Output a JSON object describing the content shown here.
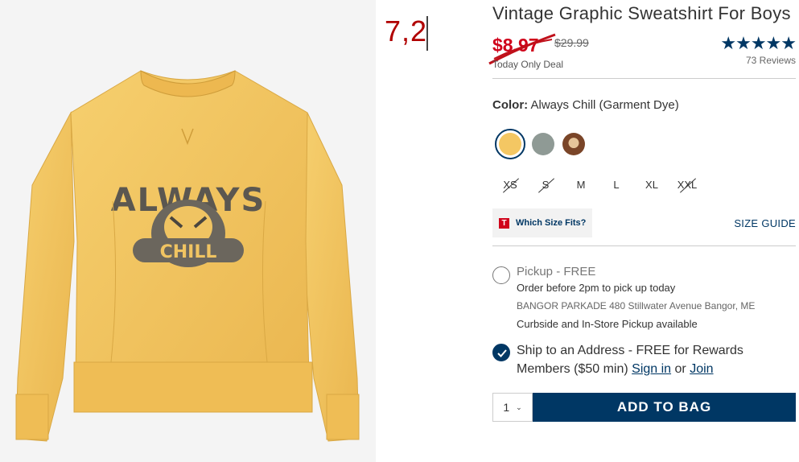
{
  "annotation": {
    "text": "7,2"
  },
  "product": {
    "title": "Vintage Graphic Sweatshirt For Boys",
    "sale_price": "$8.97",
    "original_price": "$29.99",
    "deal_label": "Today Only Deal",
    "stars": "★★★★★",
    "reviews": "73 Reviews",
    "rating": 5,
    "image_text_top": "ALWAYS",
    "image_text_board": "CHILL"
  },
  "color": {
    "label": "Color:",
    "value": "Always Chill (Garment Dye)",
    "swatches": [
      {
        "name": "yellow",
        "hex": "#f4c763",
        "selected": true
      },
      {
        "name": "grey",
        "hex": "#8f9a95"
      },
      {
        "name": "brown-graphic",
        "hex": "#7a4528"
      }
    ]
  },
  "sizes": [
    {
      "label": "XS",
      "available": false
    },
    {
      "label": "S",
      "available": false
    },
    {
      "label": "M",
      "available": true
    },
    {
      "label": "L",
      "available": true
    },
    {
      "label": "XL",
      "available": true
    },
    {
      "label": "XXL",
      "available": false
    }
  ],
  "fit": {
    "badge": "T",
    "which_label": "Which Size Fits?",
    "guide_label": "SIZE GUIDE"
  },
  "pickup": {
    "title": "Pickup - FREE",
    "subtitle": "Order before 2pm to pick up today",
    "store": "BANGOR PARKADE 480 Stillwater Avenue  Bangor, ME",
    "curbside": "Curbside and In-Store Pickup available"
  },
  "ship": {
    "text_a": "Ship to an Address - FREE for Rewards Members ($50 min) ",
    "sign_in": "Sign in",
    "or": " or ",
    "join": "Join"
  },
  "bag": {
    "qty": "1",
    "chevron": "⌄",
    "add_label": "ADD TO BAG"
  },
  "colors": {
    "brand_navy": "#003764",
    "sale_red": "#d0021b",
    "annotation_red": "#b00000"
  }
}
